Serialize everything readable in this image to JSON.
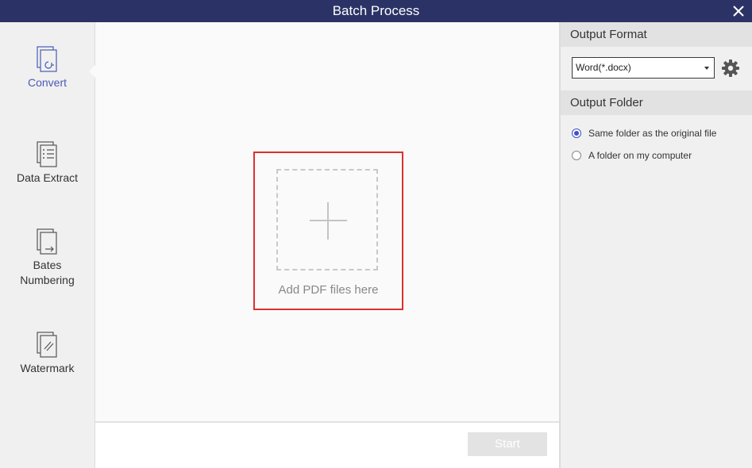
{
  "window": {
    "title": "Batch Process"
  },
  "sidebar": {
    "items": [
      {
        "label": "Convert",
        "icon": "convert-icon",
        "active": true
      },
      {
        "label": "Data Extract",
        "icon": "data-extract-icon"
      },
      {
        "label": "Bates",
        "label2": "Numbering",
        "icon": "bates-numbering-icon"
      },
      {
        "label": "Watermark",
        "icon": "watermark-icon"
      }
    ]
  },
  "main": {
    "drop_label": "Add PDF files here",
    "start_label": "Start"
  },
  "right": {
    "output_format_title": "Output Format",
    "format_value": "Word(*.docx)",
    "output_folder_title": "Output Folder",
    "options": [
      {
        "label": "Same folder as the original file",
        "checked": true
      },
      {
        "label": "A folder on my computer",
        "checked": false
      }
    ]
  },
  "colors": {
    "titlebar": "#2b3366",
    "accent": "#4a5bb5",
    "drop_border": "#d9322e"
  }
}
